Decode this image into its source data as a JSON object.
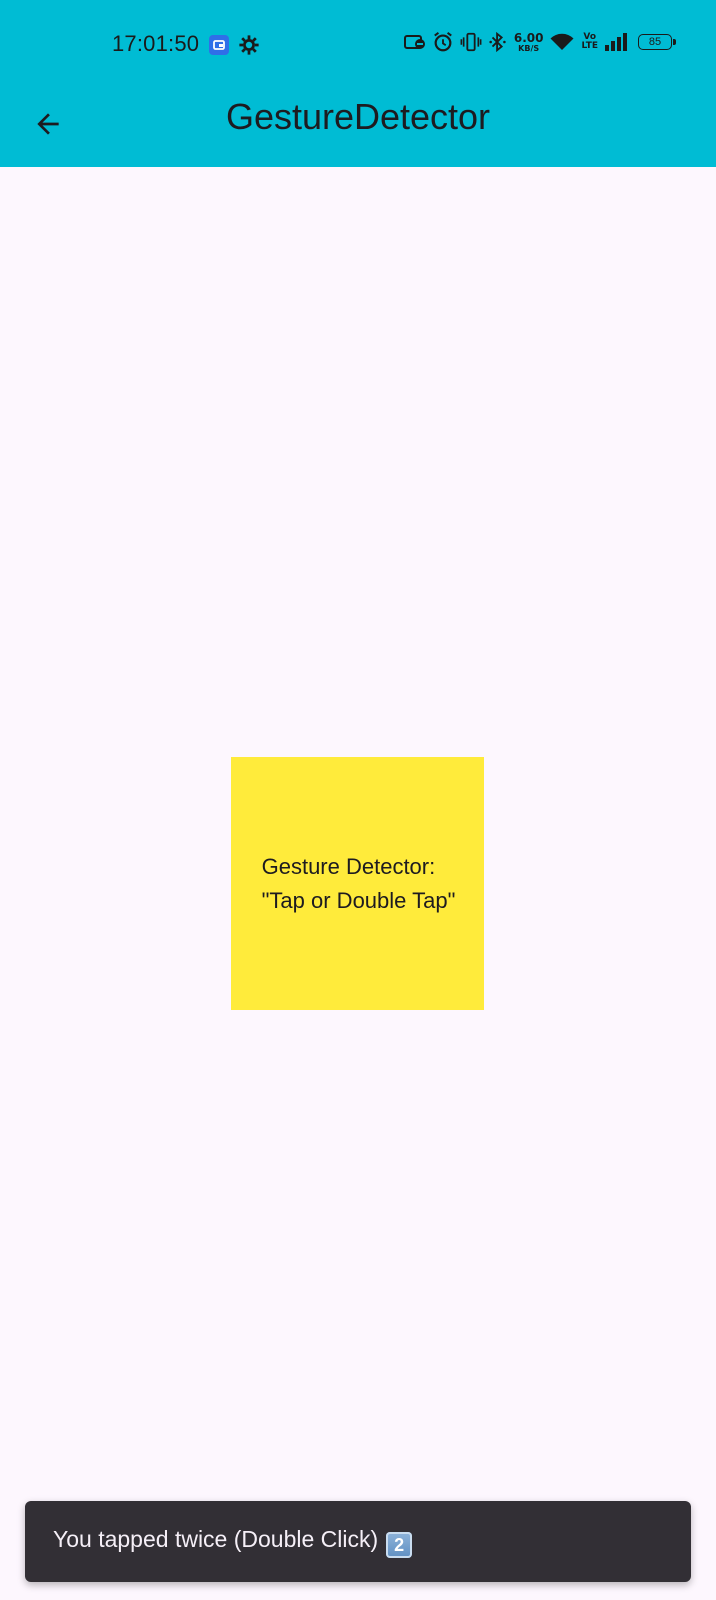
{
  "status_bar": {
    "time": "17:01:50",
    "net_speed_value": "6.00",
    "net_speed_unit": "KB/S",
    "volte_top": "Vo",
    "volte_bottom": "LTE",
    "battery_level": "85",
    "icons": [
      "app-notification-icon",
      "settings-gear-icon",
      "screen-record-icon",
      "alarm-icon",
      "vibrate-icon",
      "bluetooth-icon",
      "wifi-icon",
      "signal-icon",
      "battery-icon"
    ]
  },
  "app_bar": {
    "title": "GestureDetector",
    "back_icon": "arrow-back-icon",
    "background_color": "#00bcd4"
  },
  "gesture_box": {
    "line1": "Gesture Detector:",
    "line2": "\"Tap or Double Tap\"",
    "color": "#ffeb3b"
  },
  "snackbar": {
    "message": "You tapped twice (Double Click)",
    "emoji": "2"
  }
}
